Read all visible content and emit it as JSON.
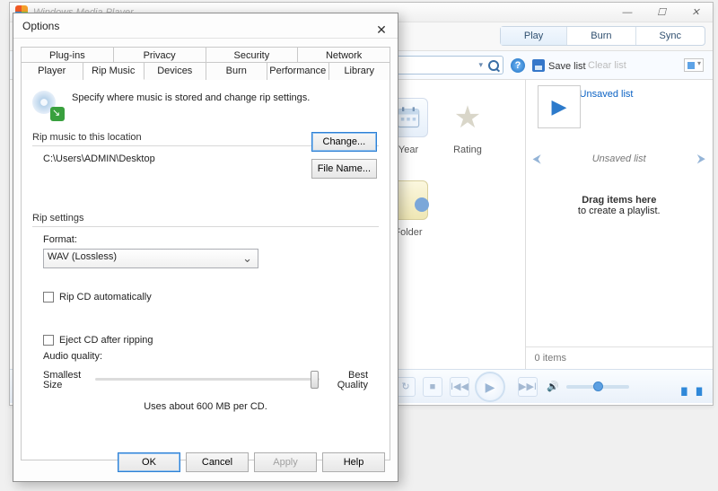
{
  "wmp": {
    "title": "Windows Media Player",
    "tabs": {
      "play": "Play",
      "burn": "Burn",
      "sync": "Sync",
      "active": "play"
    },
    "saveList": "Save list",
    "clearList": "Clear list",
    "help": "?",
    "libraryIcons": {
      "year": "Year",
      "rating": "Rating",
      "cfolder": "Folder"
    },
    "playlist": {
      "title": "Unsaved list",
      "navTitle": "Unsaved list",
      "drag1": "Drag items here",
      "drag2": "to create a playlist.",
      "count": "0 items"
    },
    "sys": {
      "min": "—",
      "max": "☐",
      "close": "✕"
    }
  },
  "dlg": {
    "title": "Options",
    "tabsRow1": [
      "Plug-ins",
      "Privacy",
      "Security",
      "Network"
    ],
    "tabsRow2": [
      "Player",
      "Rip Music",
      "Devices",
      "Burn",
      "Performance",
      "Library"
    ],
    "activeTab": "Rip Music",
    "intro": "Specify where music is stored and change rip settings.",
    "locGroup": "Rip music to this location",
    "path": "C:\\Users\\ADMIN\\Desktop",
    "changeBtn": "Change...",
    "fileNameBtn": "File Name...",
    "settingsGroup": "Rip settings",
    "formatLbl": "Format:",
    "formatValue": "WAV (Lossless)",
    "chkAuto": "Rip CD automatically",
    "chkEject": "Eject CD after ripping",
    "audioLbl": "Audio quality:",
    "sliderLeft": "Smallest\nSize",
    "sliderRight": "Best\nQuality",
    "sliderPos": 0.98,
    "storage": "Uses about 600 MB per CD.",
    "buttons": {
      "ok": "OK",
      "cancel": "Cancel",
      "apply": "Apply",
      "help": "Help"
    }
  }
}
